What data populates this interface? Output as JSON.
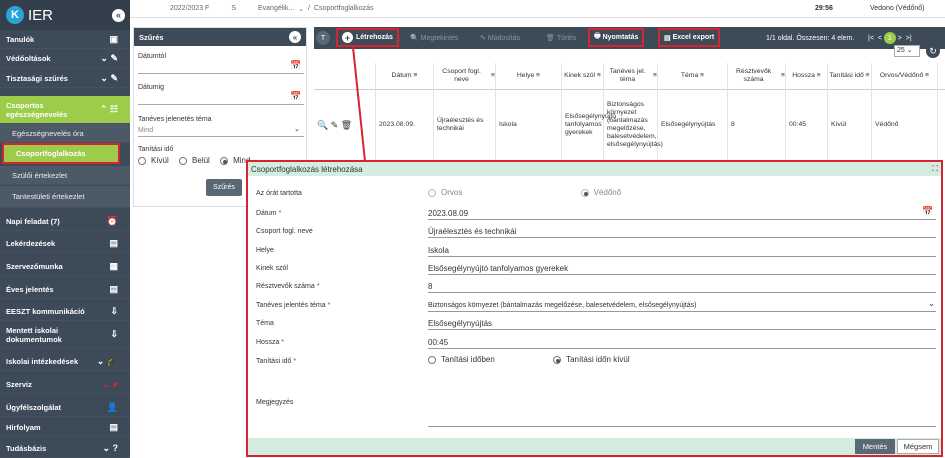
{
  "app": {
    "title": "IER"
  },
  "sidebar": {
    "items": [
      {
        "label": "Tanulók",
        "icon": "▣"
      },
      {
        "label": "Védőoltások",
        "icon": "⌄ ✎"
      },
      {
        "label": "Tisztasági szűrés",
        "icon": "⌄ ✎"
      },
      {
        "label": "Csoportos egészségnevelés",
        "icon": "⌃ ☷"
      },
      {
        "label": "Egészségnevelés óra"
      },
      {
        "label": "Csoportfoglalkozás"
      },
      {
        "label": "Szülői értekezlet"
      },
      {
        "label": "Tantestületi értekezlet"
      },
      {
        "label": "Napi feladat",
        "count": "(7)",
        "icon": "⏰"
      },
      {
        "label": "Lekérdezések",
        "icon": "▤"
      },
      {
        "label": "Szervezőmunka",
        "icon": "▦"
      },
      {
        "label": "Éves jelentés",
        "icon": "▤"
      },
      {
        "label": "EESZT kommunikáció",
        "icon": "⇩"
      },
      {
        "label": "Mentett iskolai dokumentumok",
        "icon": "⇩"
      },
      {
        "label": "Iskolai intézkedések",
        "icon": "⌄ 🎓"
      },
      {
        "label": "Szerviz",
        "icon": "⌄ ●"
      },
      {
        "label": "Ügyfélszolgálat",
        "icon": "👤"
      },
      {
        "label": "Hírfolyam",
        "icon": "▤"
      },
      {
        "label": "Tudásbázis",
        "icon": "⌄ ?"
      }
    ]
  },
  "topbar": {
    "year": "2022/2023 F",
    "s": "S",
    "school": "Evangélik...",
    "sep": "/",
    "breadcrumb": "Csoportfoglalkozás",
    "time": "29:56",
    "user": "Vedono (Védőnő)"
  },
  "filter": {
    "title": "Szűrés",
    "date_from": "Dátumtól",
    "date_to": "Dátumig",
    "topic_label": "Tanéves jelenetés téma",
    "topic_value": "Mind",
    "time_label": "Tanítási idő",
    "opt_out": "Kívül",
    "opt_in": "Belül",
    "opt_all": "Mind",
    "button": "Szűrés"
  },
  "toolbar": {
    "create": "Létrehozás",
    "view": "Megtekintés",
    "modify": "Módosítás",
    "delete": "Törlés",
    "print": "Nyomtatás",
    "excel": "Excel export",
    "paging": "1/1 oldal. Összesen: 4 elem.",
    "page": "1",
    "page_size": "25"
  },
  "grid": {
    "headers": [
      "Dátum",
      "Csoport fogl. neve",
      "Helye",
      "Kinek szól",
      "Tanéves jel. téma",
      "Téma",
      "Résztvevők száma",
      "Hossza",
      "Tanítási idő",
      "Orvos/Védőnő"
    ],
    "row": [
      "2023.08.09.",
      "Újraélesztés és technikái",
      "Iskola",
      "Elsősegélynyújtó tanfolyamos gyerekek",
      "Biztonságos környezet (bántalmazás megelőzése, balesetvédelem, elsősegélynyújtás)",
      "Elsősegélynyújtás",
      "8",
      "00:45",
      "Kívül",
      "Védőnő"
    ]
  },
  "modal": {
    "title": "Csoportfoglalkozás létrehozása",
    "held_by": "Az órát tartotta",
    "doctor": "Orvos",
    "nurse": "Védőnő",
    "fields": [
      {
        "label": "Dátum",
        "req": "*",
        "value": "2023.08.09"
      },
      {
        "label": "Csoport fogl. neve",
        "req": "",
        "value": "Újraélesztés és technikái"
      },
      {
        "label": "Helye",
        "req": "",
        "value": "Iskola"
      },
      {
        "label": "Kinek szól",
        "req": "",
        "value": "Elsősegélynyújtó tanfolyamos gyerekek"
      },
      {
        "label": "Résztvevők száma",
        "req": "*",
        "value": "8"
      },
      {
        "label": "Tanéves jelentés téma",
        "req": "*",
        "value": "Biztonságos környezet (bántalmazás megelőzése, balesetvédelem, elsősegélynyújtás)"
      },
      {
        "label": "Téma",
        "req": "",
        "value": "Elsősegélynyújtás"
      },
      {
        "label": "Hossza",
        "req": "*",
        "value": "00:45"
      }
    ],
    "teaching_label": "Tanítási idő",
    "teaching_req": "*",
    "teaching_in": "Tanítási időben",
    "teaching_out": "Tanítási időn kívül",
    "note_label": "Megjegyzés",
    "save": "Mentés",
    "cancel": "Mégsem"
  }
}
